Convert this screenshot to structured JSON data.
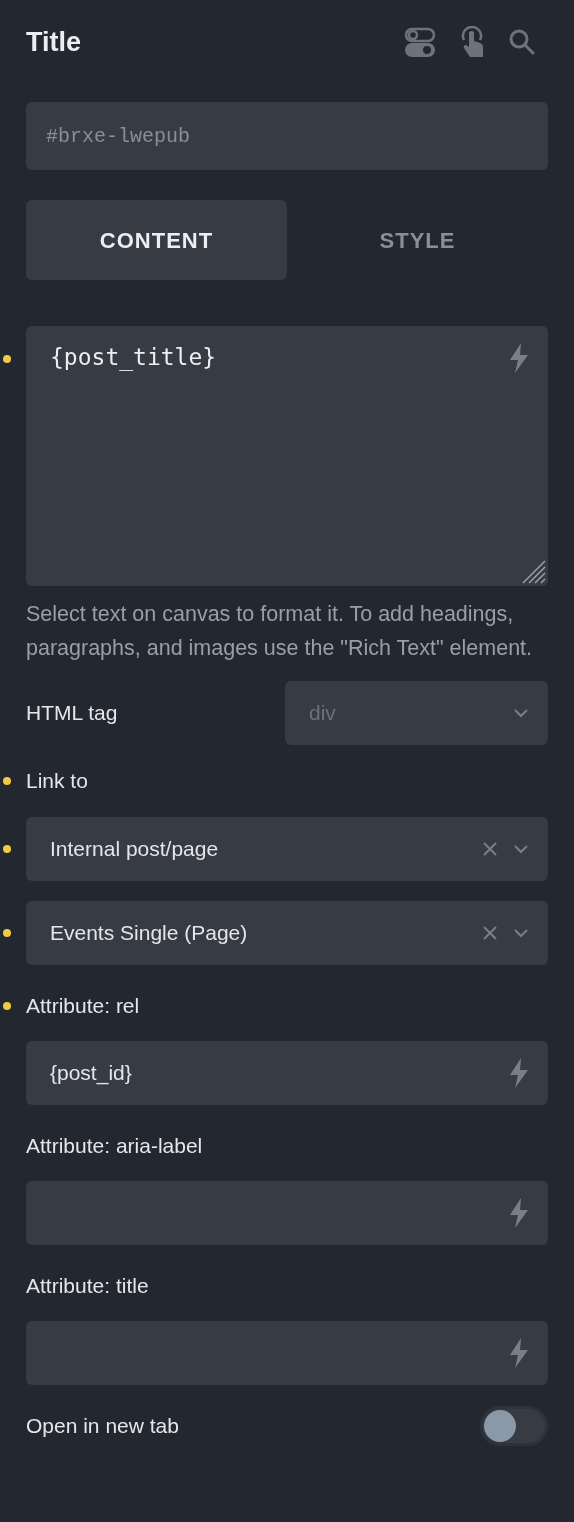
{
  "panel": {
    "title": "Title"
  },
  "element_id": {
    "placeholder": "#brxe-lwepub"
  },
  "tabs": [
    {
      "label": "CONTENT",
      "selected": true
    },
    {
      "label": "STYLE",
      "selected": false
    }
  ],
  "controls": [
    {
      "kind": "textarea",
      "value": "{post_title}",
      "modified": true,
      "dynamic": true
    },
    {
      "kind": "help",
      "text": "Select text on canvas to format it. To add headings, paragraphs, and images use the \"Rich Text\" element."
    },
    {
      "kind": "inline_select",
      "label": "HTML tag",
      "placeholder": "div"
    },
    {
      "kind": "label",
      "label": "Link to",
      "modified": true
    },
    {
      "kind": "select",
      "value": "Internal post/page",
      "modified": true,
      "clearable": true
    },
    {
      "kind": "select",
      "value": "Events Single (Page)",
      "modified": true,
      "clearable": true
    },
    {
      "kind": "label",
      "label": "Attribute: rel",
      "modified": true
    },
    {
      "kind": "input",
      "value": "{post_id}",
      "dynamic": true
    },
    {
      "kind": "label",
      "label": "Attribute: aria-label",
      "modified": false
    },
    {
      "kind": "input",
      "dynamic": true
    },
    {
      "kind": "label",
      "label": "Attribute: title",
      "modified": false
    },
    {
      "kind": "input",
      "dynamic": true
    },
    {
      "kind": "toggle",
      "label": "Open in new tab",
      "on": false
    }
  ]
}
